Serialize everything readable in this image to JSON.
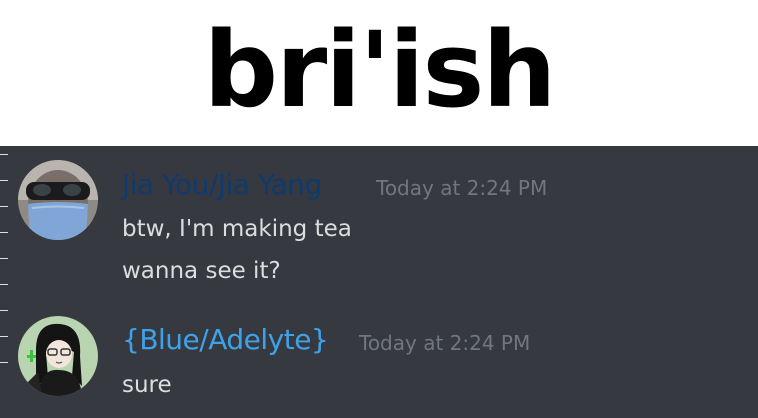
{
  "caption": {
    "text": "bri'ish"
  },
  "messages": [
    {
      "username": "Jia You/Jia Yang",
      "username_color": "#0f3a6e",
      "timestamp": "Today at 2:24 PM",
      "lines": [
        "btw, I'm making tea",
        "wanna see it?"
      ],
      "avatar_icon": "masked-man-avatar"
    },
    {
      "username": "{Blue/Adelyte}",
      "username_color": "#3fa2e8",
      "timestamp": "Today at 2:24 PM",
      "lines": [
        "sure"
      ],
      "avatar_icon": "anime-girl-avatar"
    }
  ],
  "colors": {
    "chat_background": "#36393f",
    "message_text": "#dcddde",
    "timestamp_text": "#72767d"
  }
}
